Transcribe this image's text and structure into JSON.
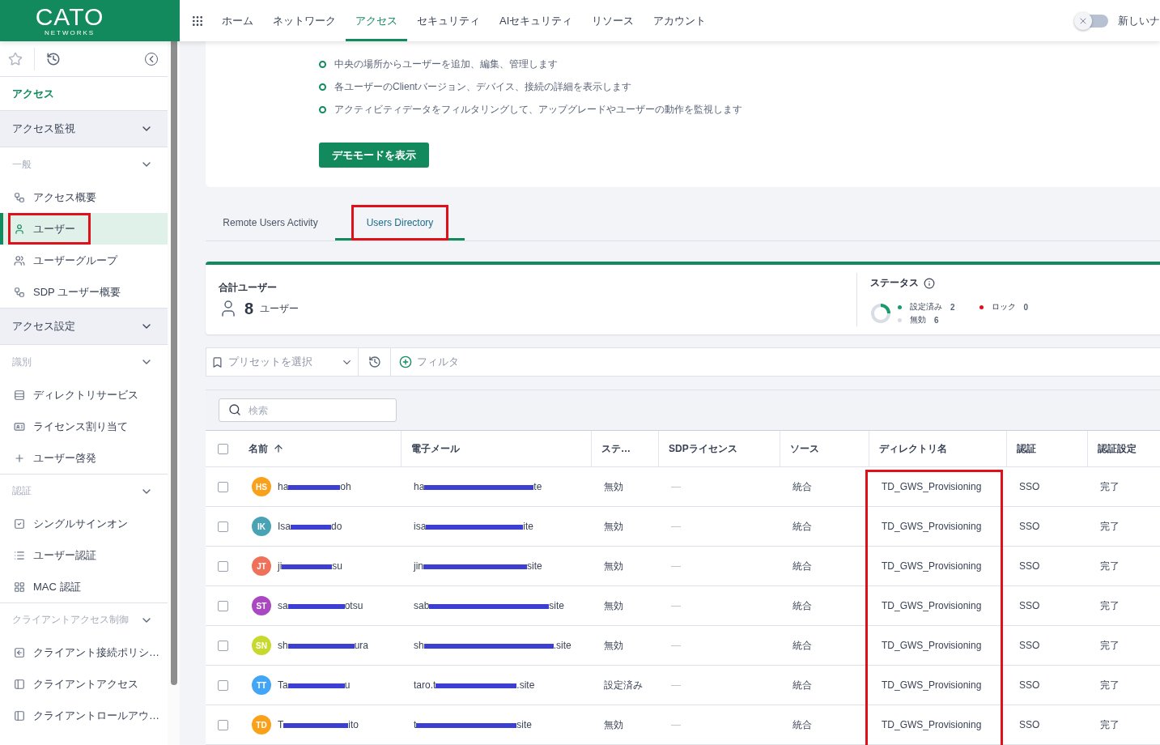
{
  "logo": {
    "name": "CATO",
    "tagline": "NETWORKS"
  },
  "top_nav": {
    "items": [
      {
        "label": "ホーム",
        "selected": false
      },
      {
        "label": "ネットワーク",
        "selected": false
      },
      {
        "label": "アクセス",
        "selected": true
      },
      {
        "label": "セキュリティ",
        "selected": false
      },
      {
        "label": "AIセキュリティ",
        "selected": false
      },
      {
        "label": "リソース",
        "selected": false
      },
      {
        "label": "アカウント",
        "selected": false
      }
    ],
    "toggle": {
      "on": false
    },
    "toggle_label": "新しいナ"
  },
  "sidebar": {
    "title": "アクセス",
    "sections": [
      {
        "kind": "section",
        "label": "アクセス監視"
      },
      {
        "kind": "group",
        "label": "一般",
        "children": [
          {
            "label": "アクセス概要",
            "selected": false,
            "highlighted": false
          },
          {
            "label": "ユーザー",
            "selected": true,
            "highlighted": true
          },
          {
            "label": "ユーザーグループ",
            "selected": false,
            "highlighted": false
          },
          {
            "label": "SDP ユーザー概要",
            "selected": false,
            "highlighted": false
          }
        ]
      },
      {
        "kind": "section",
        "label": "アクセス設定"
      },
      {
        "kind": "group",
        "label": "識別",
        "children": [
          {
            "label": "ディレクトリサービス",
            "selected": false,
            "highlighted": false
          },
          {
            "label": "ライセンス割り当て",
            "selected": false,
            "highlighted": false
          },
          {
            "label": "ユーザー啓発",
            "selected": false,
            "highlighted": false
          }
        ]
      },
      {
        "kind": "group",
        "label": "認証",
        "children": [
          {
            "label": "シングルサインオン",
            "selected": false,
            "highlighted": false
          },
          {
            "label": "ユーザー認証",
            "selected": false,
            "highlighted": false
          },
          {
            "label": "MAC 認証",
            "selected": false,
            "highlighted": false
          }
        ]
      },
      {
        "kind": "group",
        "label": "クライアントアクセス制御",
        "children": [
          {
            "label": "クライアント接続ポリシ…",
            "selected": false,
            "highlighted": false
          },
          {
            "label": "クライアントアクセス",
            "selected": false,
            "highlighted": false
          },
          {
            "label": "クライアントロールアウ…",
            "selected": false,
            "highlighted": false
          }
        ]
      }
    ]
  },
  "intro": {
    "bullets": [
      "中央の場所からユーザーを追加、編集、管理します",
      "各ユーザーのClientバージョン、デバイス、接続の詳細を表示します",
      "アクティビティデータをフィルタリングして、アップグレードやユーザーの動作を監視します"
    ],
    "button": "デモモードを表示"
  },
  "tabs": [
    {
      "label": "Remote Users Activity",
      "selected": false,
      "highlighted": false
    },
    {
      "label": "Users Directory",
      "selected": true,
      "highlighted": true
    }
  ],
  "summary": {
    "title": "合計ユーザー",
    "count": "8",
    "unit": "ユーザー",
    "status_title": "ステータス",
    "donut": {
      "level": 0.25
    },
    "legend": [
      {
        "label": "設定済み",
        "value": "2",
        "color": "#1a9b6c"
      },
      {
        "label": "無効",
        "value": "6",
        "color": "#d9dde5"
      },
      {
        "label": "ロック",
        "value": "0",
        "color": "#e0101a"
      }
    ]
  },
  "filter_bar": {
    "preset": "プリセットを選択",
    "filter": "フィルタ"
  },
  "search": {
    "placeholder": "検索"
  },
  "table": {
    "select_all": {
      "checked": false
    },
    "columns": [
      {
        "label": "名前",
        "sorted": true,
        "highlighted": false
      },
      {
        "label": "電子メール",
        "sorted": false,
        "highlighted": false
      },
      {
        "label": "ステ…",
        "sorted": false,
        "highlighted": false
      },
      {
        "label": "SDPライセンス",
        "sorted": false,
        "highlighted": false
      },
      {
        "label": "ソース",
        "sorted": false,
        "highlighted": false
      },
      {
        "label": "ディレクトリ名",
        "sorted": false,
        "highlighted": true
      },
      {
        "label": "認証",
        "sorted": false,
        "highlighted": false
      },
      {
        "label": "認証設定",
        "sorted": false,
        "highlighted": false
      }
    ],
    "rows": [
      {
        "checked": false,
        "initials": "HS",
        "color": "#f9a11b",
        "name": {
          "start": "ha",
          "end": "oh"
        },
        "email": {
          "start": "ha",
          "end": "te"
        },
        "status": "無効",
        "sdp": "—",
        "source": "統合",
        "directory": "TD_GWS_Provisioning",
        "auth": "SSO",
        "auth_setting": "完了"
      },
      {
        "checked": false,
        "initials": "IK",
        "color": "#4aa3b5",
        "name": {
          "start": "Isa",
          "end": "do"
        },
        "email": {
          "start": "isa",
          "end": "ite"
        },
        "status": "無効",
        "sdp": "—",
        "source": "統合",
        "directory": "TD_GWS_Provisioning",
        "auth": "SSO",
        "auth_setting": "完了"
      },
      {
        "checked": false,
        "initials": "JT",
        "color": "#f0715a",
        "name": {
          "start": "ji",
          "end": "su"
        },
        "email": {
          "start": "jin",
          "end": "site"
        },
        "status": "無効",
        "sdp": "—",
        "source": "統合",
        "directory": "TD_GWS_Provisioning",
        "auth": "SSO",
        "auth_setting": "完了"
      },
      {
        "checked": false,
        "initials": "ST",
        "color": "#a948c0",
        "name": {
          "start": "sa",
          "end": "otsu"
        },
        "email": {
          "start": "sab",
          "end": "site"
        },
        "status": "無効",
        "sdp": "—",
        "source": "統合",
        "directory": "TD_GWS_Provisioning",
        "auth": "SSO",
        "auth_setting": "完了"
      },
      {
        "checked": false,
        "initials": "SN",
        "color": "#c8d92e",
        "name": {
          "start": "sh",
          "end": "ura"
        },
        "email": {
          "start": "sh",
          "end": ".site"
        },
        "status": "無効",
        "sdp": "—",
        "source": "統合",
        "directory": "TD_GWS_Provisioning",
        "auth": "SSO",
        "auth_setting": "完了"
      },
      {
        "checked": false,
        "initials": "TT",
        "color": "#42a5f5",
        "name": {
          "start": "Ta",
          "end": "u"
        },
        "email": {
          "start": "taro.t",
          "end": ".site"
        },
        "status": "設定済み",
        "sdp": "—",
        "source": "統合",
        "directory": "TD_GWS_Provisioning",
        "auth": "SSO",
        "auth_setting": "完了"
      },
      {
        "checked": false,
        "initials": "TD",
        "color": "#f9a11b",
        "name": {
          "start": "T",
          "end": "ito"
        },
        "email": {
          "start": "t",
          "end": "site"
        },
        "status": "無効",
        "sdp": "—",
        "source": "統合",
        "directory": "TD_GWS_Provisioning",
        "auth": "SSO",
        "auth_setting": "完了"
      }
    ]
  }
}
